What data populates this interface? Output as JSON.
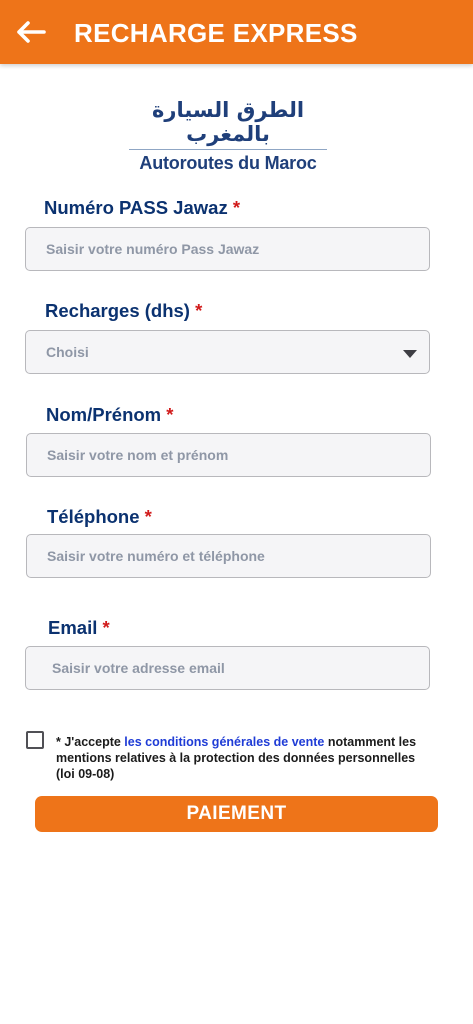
{
  "header": {
    "title": "RECHARGE EXPRESS",
    "back_icon": "arrow-left-icon",
    "background": "#ee7419"
  },
  "logo": {
    "arabic": "الطرق السيارة بالمغرب",
    "latin": "Autoroutes du Maroc"
  },
  "form": {
    "pass": {
      "label": "Numéro PASS Jawaz",
      "required_mark": "*",
      "placeholder": "Saisir votre numéro Pass Jawaz"
    },
    "recharge": {
      "label": "Recharges (dhs)",
      "required_mark": "*",
      "selected": "Choisi"
    },
    "name": {
      "label": "Nom/Prénom",
      "required_mark": "*",
      "placeholder": "Saisir votre nom et prénom"
    },
    "phone": {
      "label": "Téléphone",
      "required_mark": "*",
      "placeholder": "Saisir votre numéro et téléphone"
    },
    "email": {
      "label": "Email",
      "required_mark": "*",
      "placeholder": "Saisir votre adresse email"
    }
  },
  "terms": {
    "checked": false,
    "prefix": "* J'accepte ",
    "link": "les conditions générales de vente",
    "suffix": " notamment les mentions relatives à la protection des données personnelles (loi 09-08)"
  },
  "submit": {
    "label": "PAIEMENT"
  },
  "colors": {
    "accent": "#ee7419",
    "label": "#0b3270",
    "required": "#d11a1a",
    "link": "#1f3cd6"
  }
}
